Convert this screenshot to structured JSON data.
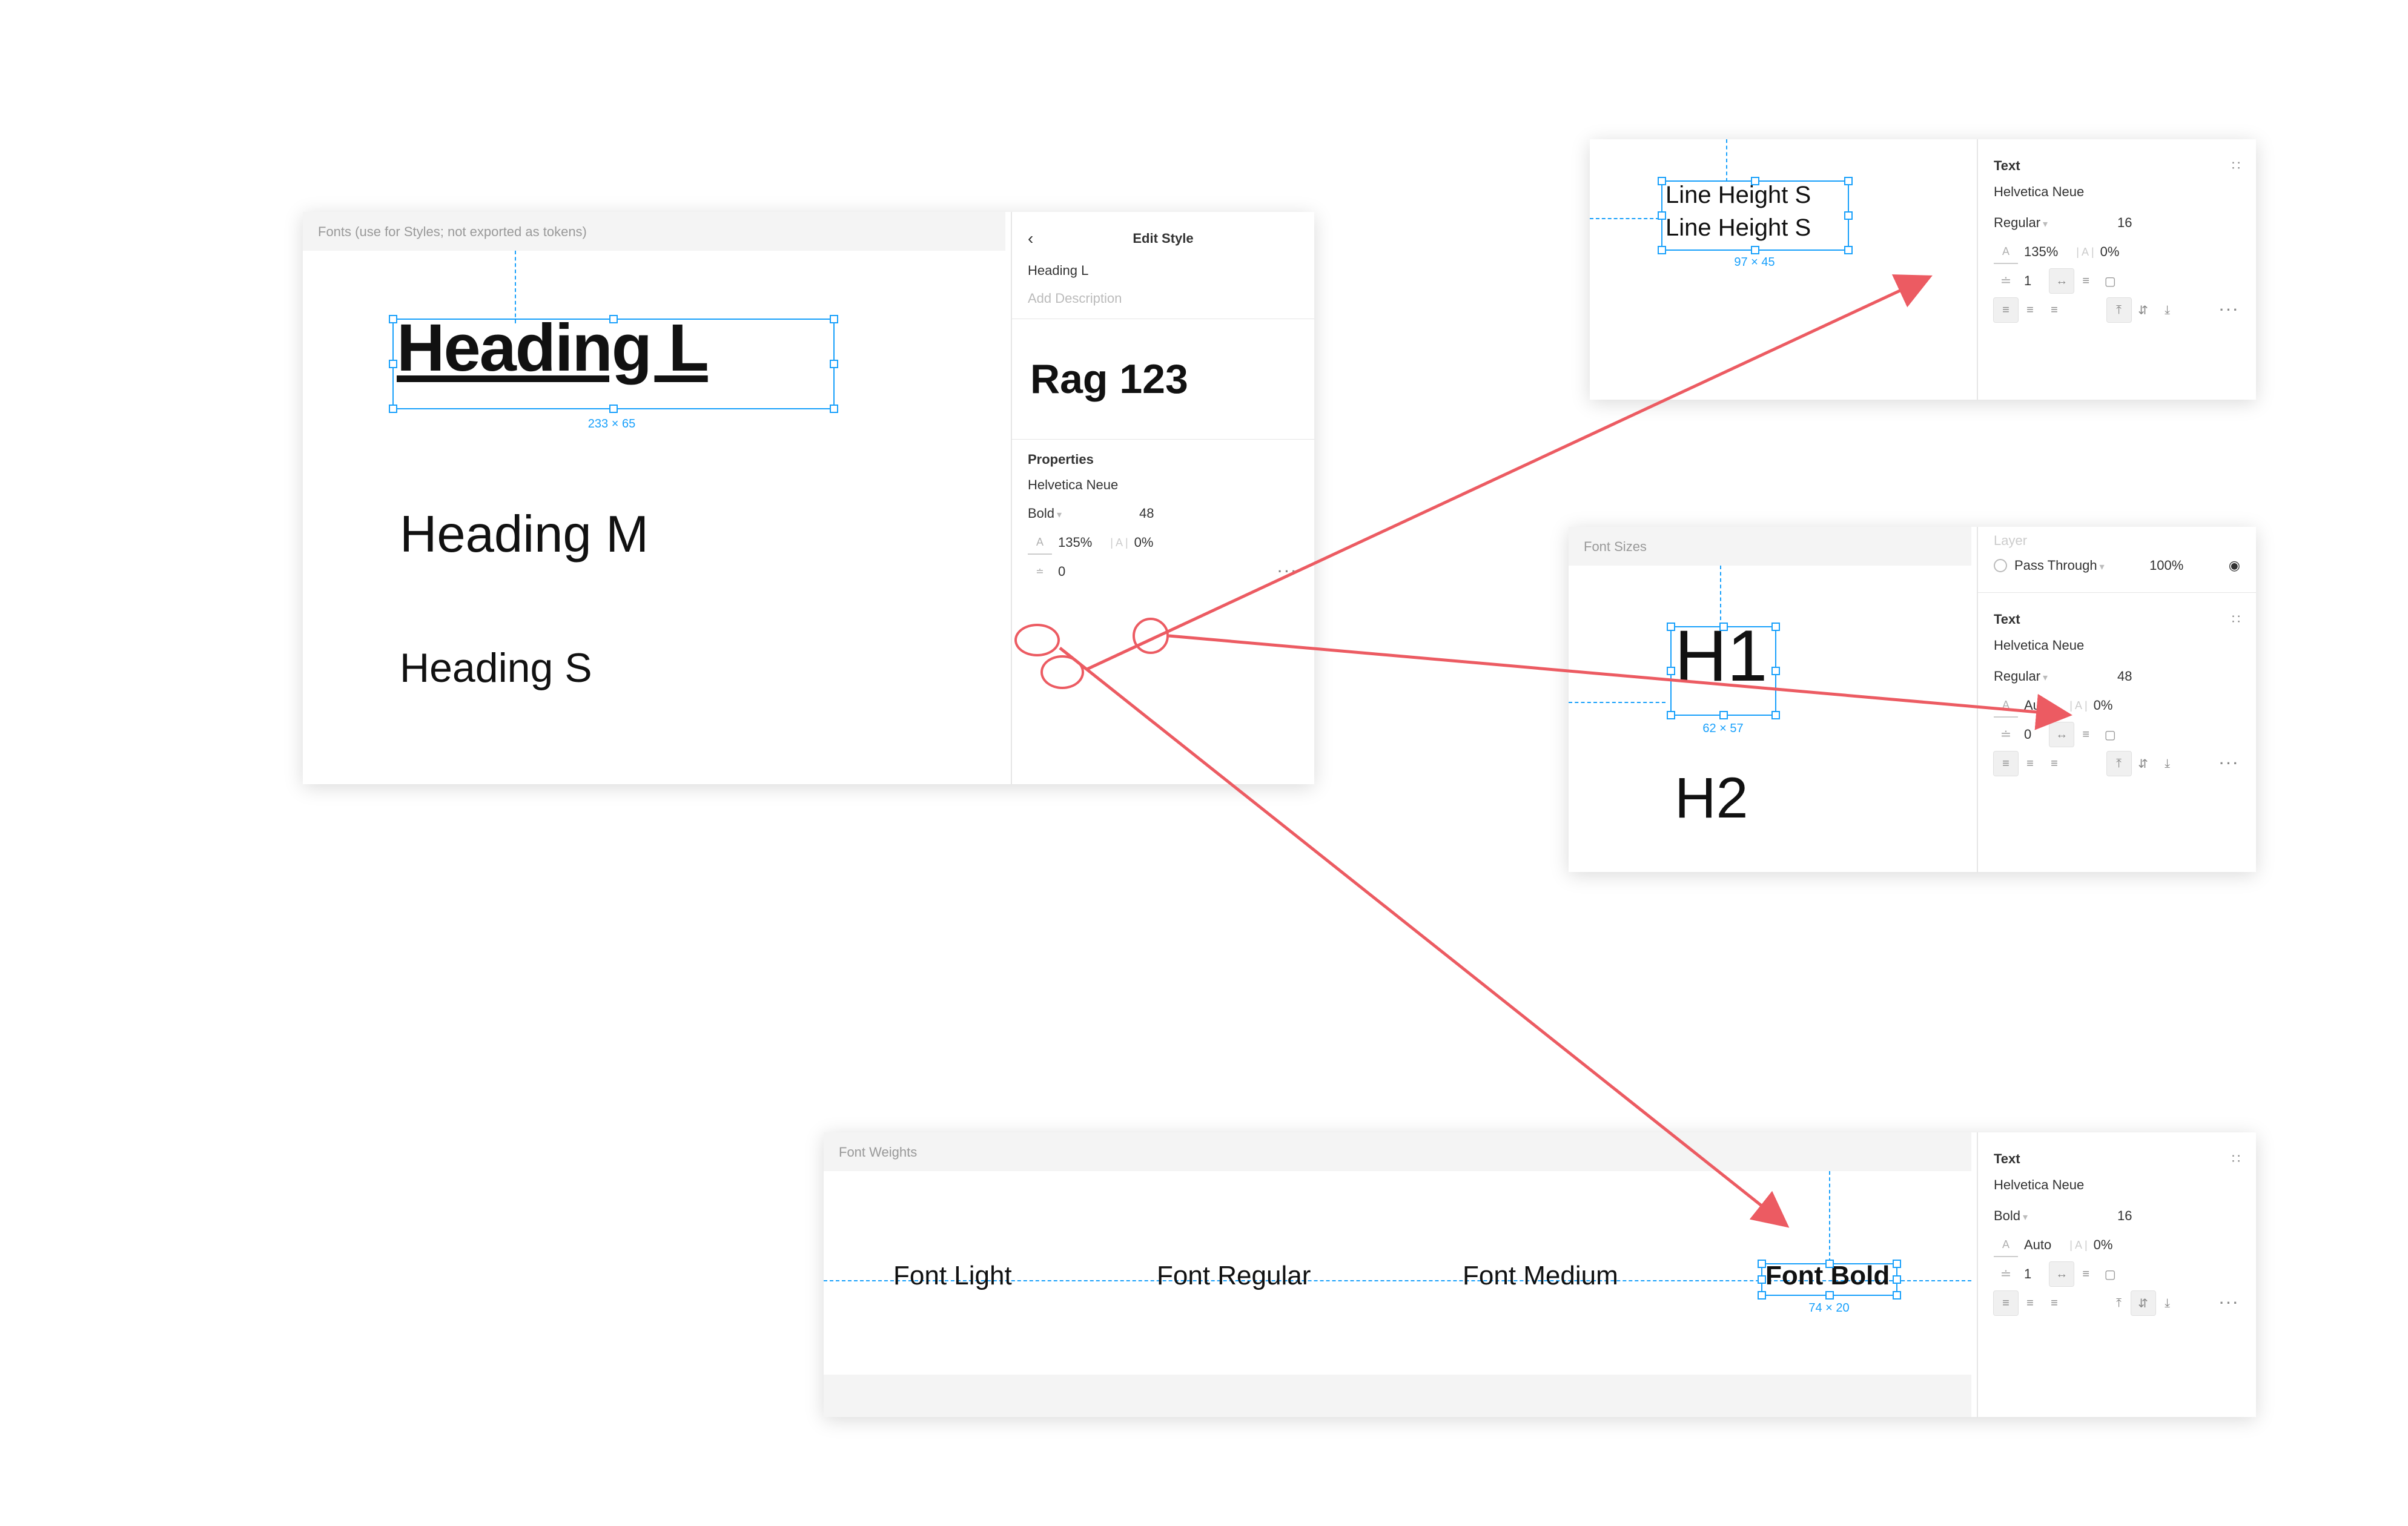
{
  "colors": {
    "accent": "#18a0fb",
    "annotation": "#ec5b62"
  },
  "panel1": {
    "frame_label": "Fonts (use for Styles; not exported as tokens)",
    "canvas": {
      "heading_l": "Heading L",
      "heading_m": "Heading M",
      "heading_s": "Heading S",
      "selected_dim": "233 × 65"
    },
    "sidebar": {
      "title": "Edit Style",
      "style_name": "Heading L",
      "add_desc": "Add Description",
      "preview": "Rag 123",
      "properties_label": "Properties",
      "font": "Helvetica Neue",
      "weight": "Bold",
      "size": "48",
      "line_height": "135%",
      "letter_spacing": "0%",
      "paragraph_spacing": "0"
    }
  },
  "panel2": {
    "canvas": {
      "line1": "Line Height S",
      "line2": "Line Height S",
      "selected_dim": "97 × 45"
    },
    "sidebar": {
      "section": "Text",
      "font": "Helvetica Neue",
      "weight": "Regular",
      "size": "16",
      "line_height": "135%",
      "letter_spacing": "0%",
      "paragraph_spacing": "1"
    }
  },
  "panel3": {
    "frame_label": "Font Sizes",
    "canvas": {
      "h1": "H1",
      "h2": "H2",
      "selected_dim": "62 × 57"
    },
    "sidebar": {
      "layer_label": "Layer",
      "blend": "Pass Through",
      "opacity": "100%",
      "section": "Text",
      "font": "Helvetica Neue",
      "weight": "Regular",
      "size": "48",
      "line_height": "Auto",
      "letter_spacing": "0%",
      "paragraph_spacing": "0"
    }
  },
  "panel4": {
    "frame_label": "Font Weights",
    "canvas": {
      "light": "Font Light",
      "regular": "Font Regular",
      "medium": "Font Medium",
      "bold": "Font Bold",
      "selected_dim": "74 × 20"
    },
    "sidebar": {
      "section": "Text",
      "font": "Helvetica Neue",
      "weight": "Bold",
      "size": "16",
      "line_height": "Auto",
      "letter_spacing": "0%",
      "paragraph_spacing": "1"
    }
  }
}
